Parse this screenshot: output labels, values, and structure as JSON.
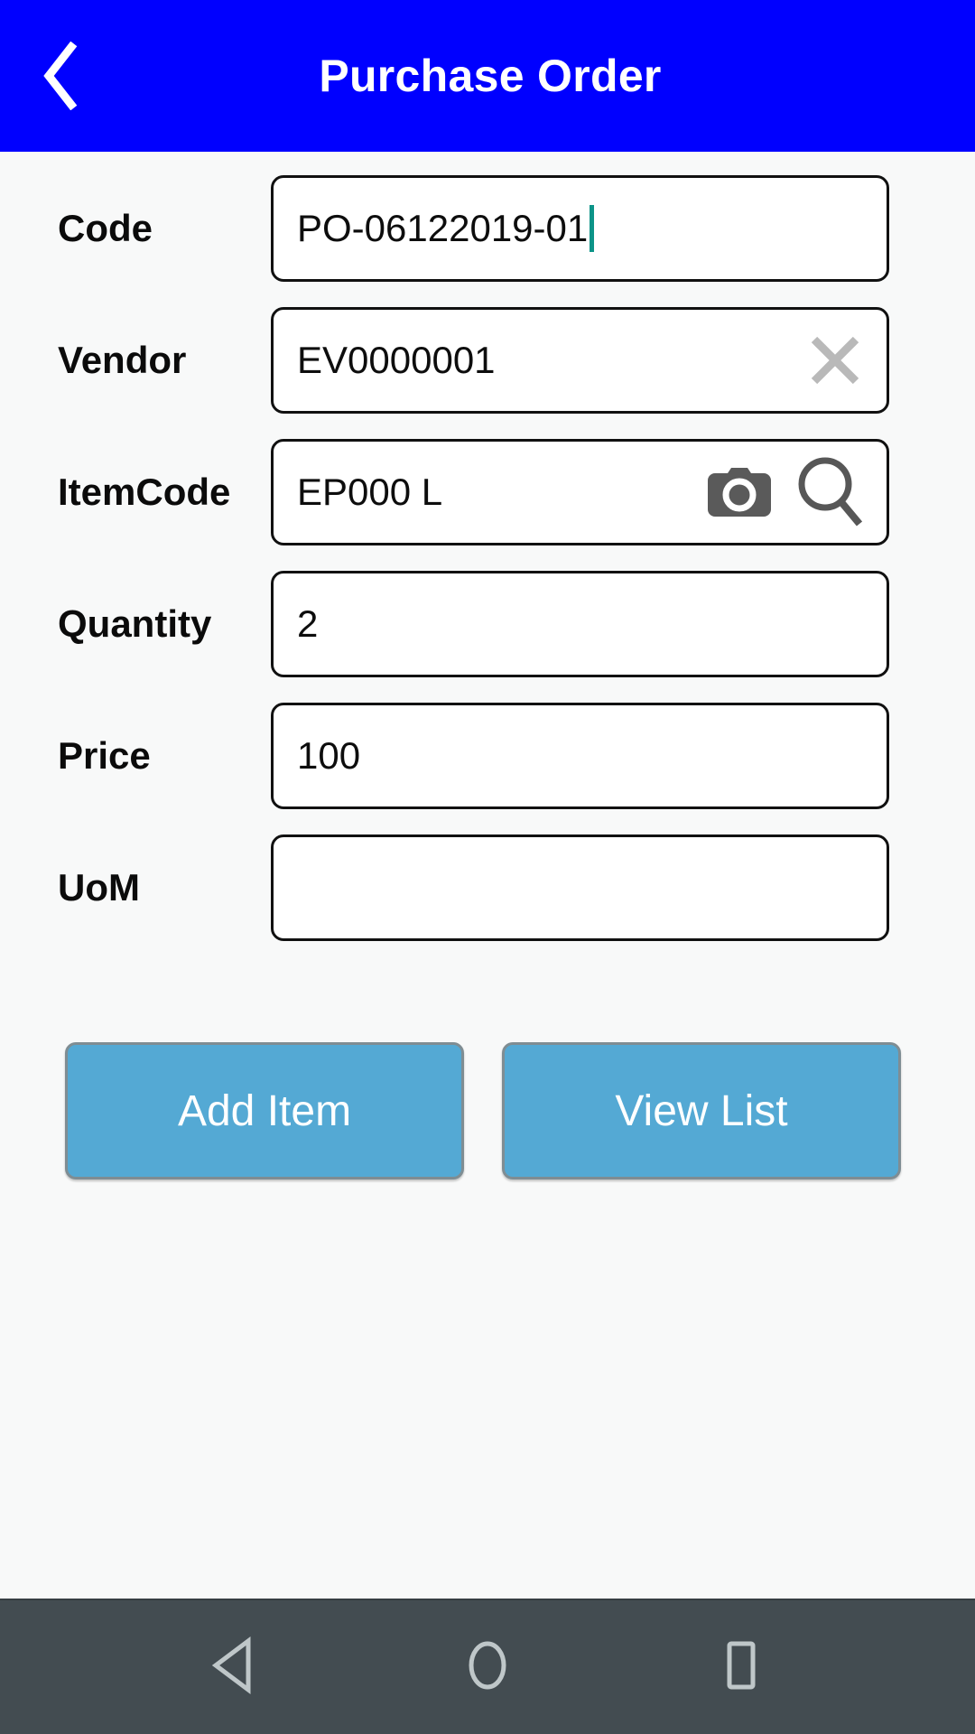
{
  "appbar": {
    "title": "Purchase Order",
    "back_icon": "chevron-left-icon",
    "background_color": "#0000FF",
    "title_color": "#FFFFFF"
  },
  "form": {
    "fields": [
      {
        "label": "Code",
        "value": "PO-06122019-01",
        "placeholder": "",
        "focused": true,
        "caret_color": "#0C9488",
        "icons": []
      },
      {
        "label": "Vendor",
        "value": "EV0000001",
        "placeholder": "",
        "focused": false,
        "icons": [
          "clear-x-icon"
        ]
      },
      {
        "label": "ItemCode",
        "value": "EP000 L",
        "placeholder": "",
        "focused": false,
        "icons": [
          "camera-icon",
          "search-icon"
        ]
      },
      {
        "label": "Quantity",
        "value": "2",
        "placeholder": "",
        "focused": false,
        "icons": []
      },
      {
        "label": "Price",
        "value": "100",
        "placeholder": "",
        "focused": false,
        "icons": []
      },
      {
        "label": "UoM",
        "value": "",
        "placeholder": "",
        "focused": false,
        "icons": []
      }
    ]
  },
  "buttons": {
    "add_item_label": "Add Item",
    "view_list_label": "View List",
    "accent_color": "#54A9D4",
    "label_color": "#FFFFFF"
  },
  "navbar": {
    "background_color": "#434C51",
    "icon_color": "#BFC7C9",
    "items": [
      {
        "name": "back-triangle-icon"
      },
      {
        "name": "home-circle-icon"
      },
      {
        "name": "recents-square-icon"
      }
    ]
  }
}
